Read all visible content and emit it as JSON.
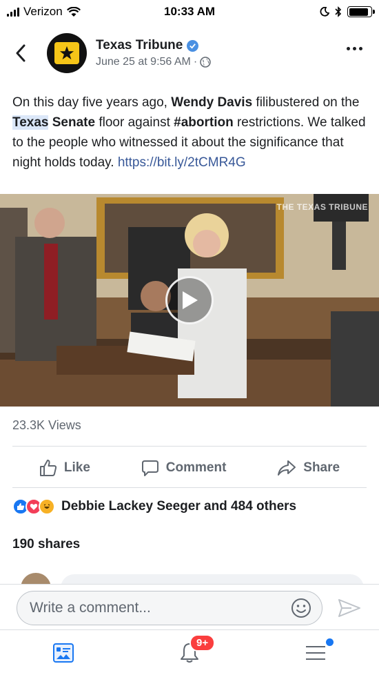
{
  "status_bar": {
    "carrier": "Verizon",
    "time": "10:33 AM",
    "battery_level": 0.9
  },
  "post": {
    "page_name": "Texas Tribune",
    "timestamp": "June 25 at 9:56 AM",
    "separator": "·",
    "text": {
      "part1": "On this day five years ago, ",
      "bold1": "Wendy Davis",
      "part2": " filibustered on the ",
      "bold2": "Texas",
      "bold3": " Senate",
      "part3": " floor against ",
      "bold4": "#abortion",
      "part4": " restrictions. We talked to the people who witnessed it about the significance that night holds today. ",
      "link": "https://bit.ly/2tCMR4G"
    },
    "video": {
      "watermark": "THE TEXAS TRIBUNE"
    },
    "views": "23.3K Views",
    "actions": {
      "like": "Like",
      "comment": "Comment",
      "share": "Share"
    },
    "reactions_text": "Debbie Lackey Seeger and 484 others",
    "shares": "190 shares"
  },
  "composer": {
    "placeholder": "Write a comment..."
  },
  "bottom_nav": {
    "notifications_badge": "9+"
  },
  "icons": {
    "back": "chevron-left-icon",
    "verified": "verified-check-icon",
    "privacy": "globe-icon",
    "more": "more-dots-icon",
    "like": "thumbs-up-icon",
    "comment": "speech-bubble-icon",
    "share": "share-arrow-icon",
    "emoji": "smiley-icon",
    "send": "send-icon",
    "feed": "news-feed-icon",
    "notifications": "bell-icon",
    "menu": "menu-icon"
  },
  "colors": {
    "brand_blue": "#1877f2",
    "link": "#385898",
    "badge_red": "#fa3e3e",
    "tribune_yellow": "#f5c518"
  }
}
